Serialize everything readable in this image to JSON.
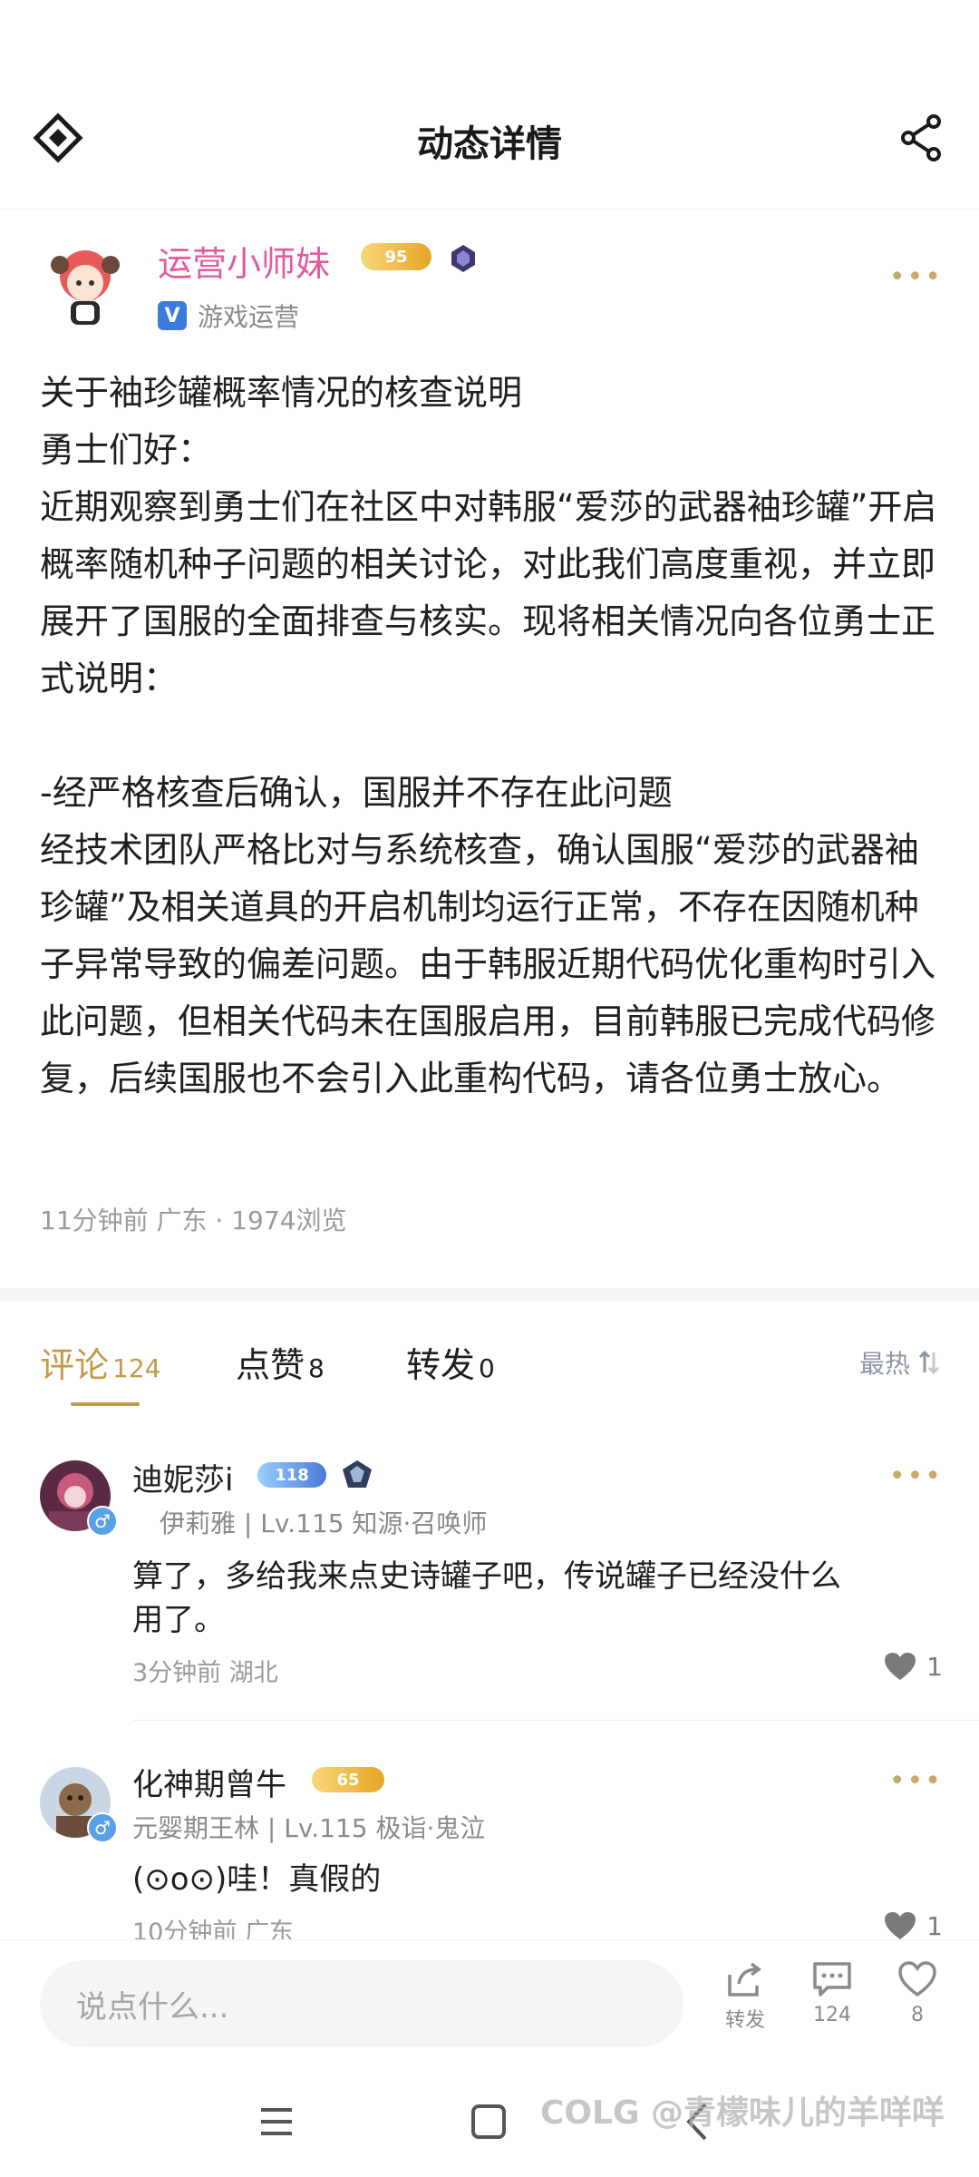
{
  "header": {
    "title": "动态详情"
  },
  "post": {
    "author": {
      "name": "运营小师妹",
      "level": "95",
      "role": "游戏运营"
    },
    "body": [
      "关于袖珍罐概率情况的核查说明",
      "勇士们好：",
      "近期观察到勇士们在社区中对韩服“爱莎的武器袖珍罐”开启概率随机种子问题的相关讨论，对此我们高度重视，并立即展开了国服的全面排查与核实。现将相关情况向各位勇士正式说明：",
      "",
      "-经严格核查后确认，国服并不存在此问题",
      "经技术团队严格比对与系统核查，确认国服“爱莎的武器袖珍罐”及相关道具的开启机制均运行正常，不存在因随机种子异常导致的偏差问题。由于韩服近期代码优化重构时引入此问题，但相关代码未在国服启用，目前韩服已完成代码修复，后续国服也不会引入此重构代码，请各位勇士放心。"
    ],
    "meta": "11分钟前  广东 · 1974浏览"
  },
  "tabs": [
    {
      "label": "评论",
      "count": "124"
    },
    {
      "label": "点赞",
      "count": "8"
    },
    {
      "label": "转发",
      "count": "0"
    }
  ],
  "sort_label": "最热",
  "comments": [
    {
      "name": "迪妮莎i",
      "level": "118",
      "sub": "伊莉雅 | Lv.115 知源·召唤师",
      "text": "算了，多给我来点史诗罐子吧，传说罐子已经没什么用了。",
      "meta": "3分钟前   湖北",
      "likes": "1"
    },
    {
      "name": "化神期曾牛",
      "level": "65",
      "sub": "元婴期王林 | Lv.115 极诣·鬼泣",
      "text": "(⊙o⊙)哇！真假的",
      "meta": "10分钟前   广东",
      "likes": "1"
    }
  ],
  "bottom_bar": {
    "placeholder": "说点什么...",
    "repost_label": "转发",
    "comment_count": "124",
    "like_count": "8"
  },
  "watermark": "COLG @青檬味儿的羊咩咩",
  "colors": {
    "accent": "#c49a4a",
    "author": "#e45aa0",
    "verified": "#3a7bdc"
  }
}
